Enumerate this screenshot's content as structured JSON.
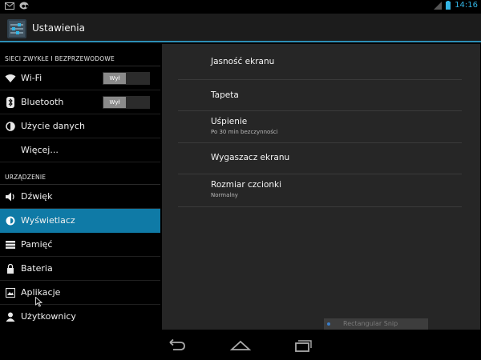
{
  "status_bar": {
    "time": "14:16"
  },
  "app_bar": {
    "title": "Ustawienia"
  },
  "sidebar": {
    "section1": "SIECI ZWYKŁE I BEZPRZEWODOWE",
    "wifi": {
      "label": "Wi-Fi",
      "toggle": "Wył"
    },
    "bluetooth": {
      "label": "Bluetooth",
      "toggle": "Wył"
    },
    "data_usage": "Użycie danych",
    "more": "Więcej...",
    "section2": "URZĄDZENIE",
    "sound": "Dźwięk",
    "display": "Wyświetlacz",
    "storage": "Pamięć",
    "battery": "Bateria",
    "apps": "Aplikacje",
    "users": "Użytkownicy"
  },
  "display_settings": {
    "brightness": "Jasność ekranu",
    "wallpaper": "Tapeta",
    "sleep": {
      "title": "Uśpienie",
      "summary": "Po 30 min bezczynności"
    },
    "screensaver": "Wygaszacz ekranu",
    "font_size": {
      "title": "Rozmiar czcionki",
      "summary": "Normalny"
    }
  },
  "overlay": {
    "snip_label": "Rectangular Snip"
  },
  "colors": {
    "accent": "#33b5e5",
    "selected": "#0f7aa6"
  }
}
